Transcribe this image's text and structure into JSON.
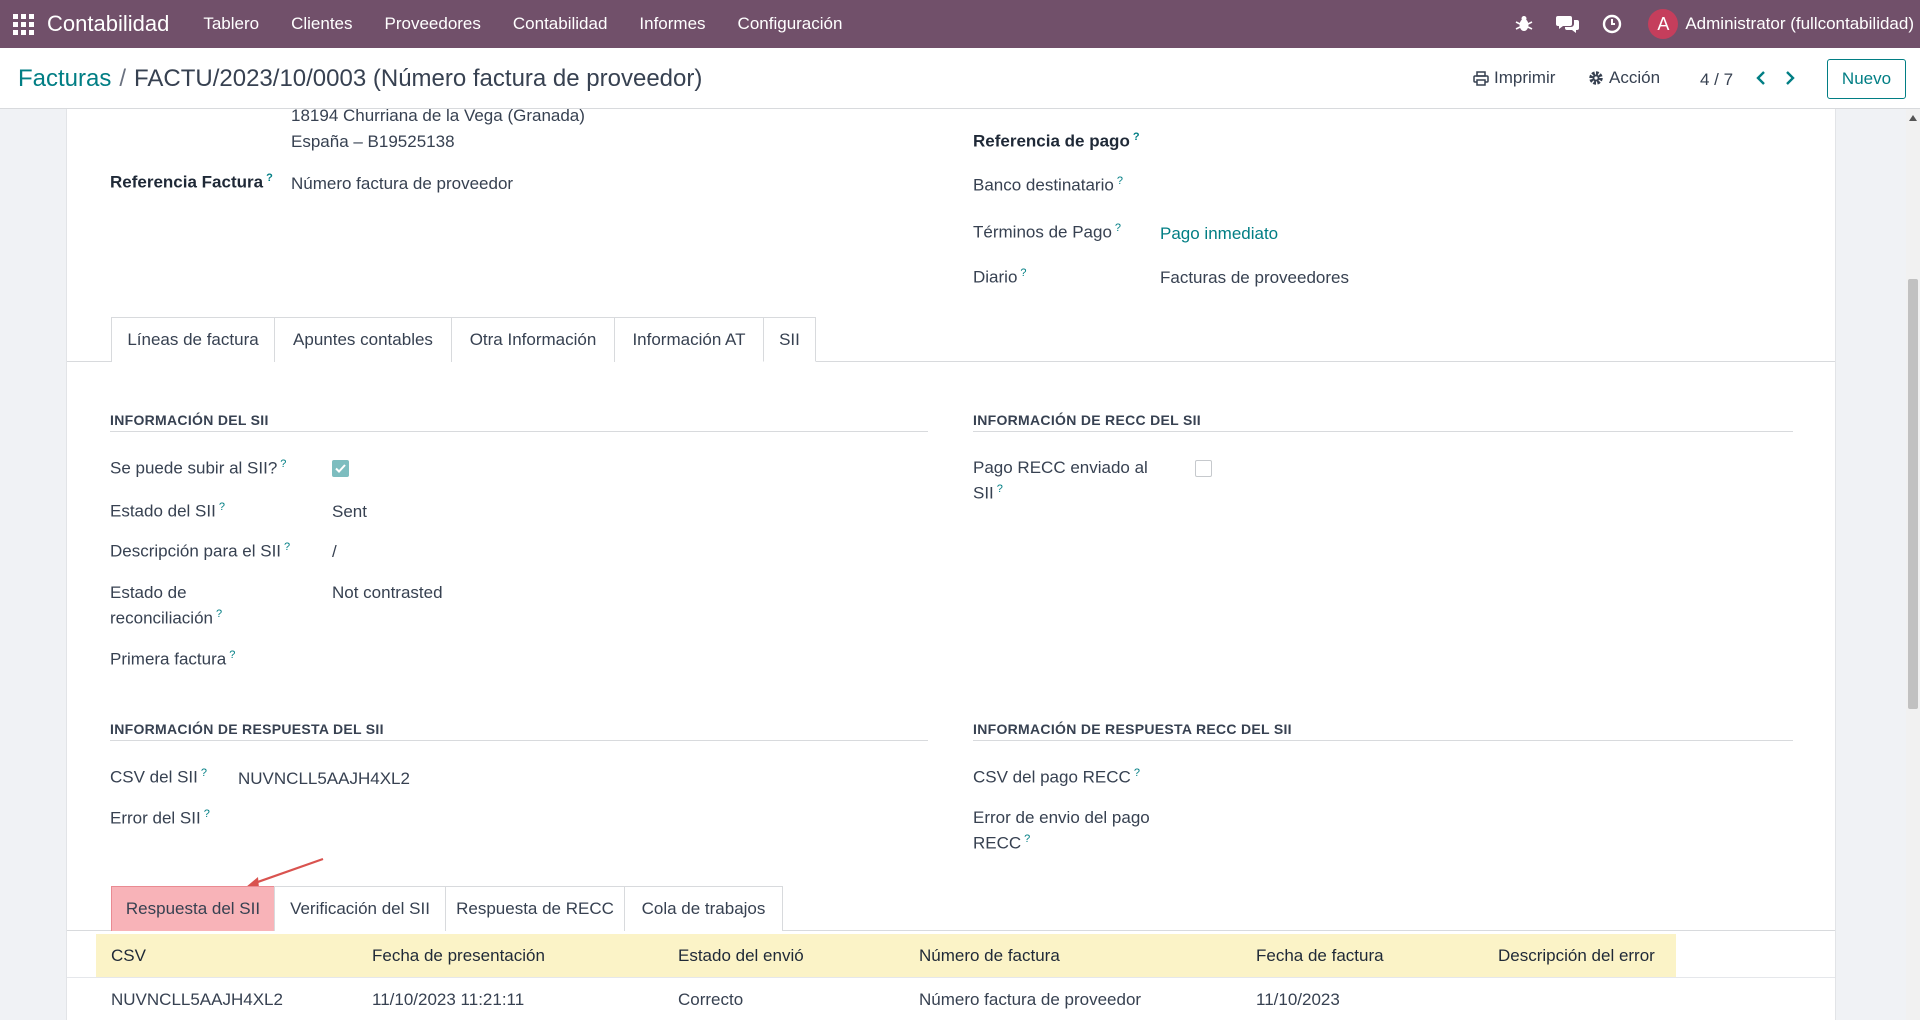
{
  "navbar": {
    "brand": "Contabilidad",
    "menu": [
      "Tablero",
      "Clientes",
      "Proveedores",
      "Contabilidad",
      "Informes",
      "Configuración"
    ],
    "avatar_letter": "A",
    "user": "Administrator (fullcontabilidad)"
  },
  "control": {
    "breadcrumb_parent": "Facturas",
    "breadcrumb_separator": "/",
    "breadcrumb_current": "FACTU/2023/10/0003 (Número factura de proveedor)",
    "print_label": "Imprimir",
    "action_label": "Acción",
    "pager": "4 / 7",
    "new_label": "Nuevo"
  },
  "partner": {
    "address_line": "18194 Churriana de la Vega (Granada)",
    "country_vat": "España – B19525138"
  },
  "fields_left": {
    "invoice_ref_label": "Referencia Factura",
    "invoice_ref_value": "Número factura de proveedor"
  },
  "fields_right": {
    "payment_ref_label": "Referencia de pago",
    "bank_label": "Banco destinatario",
    "terms_label": "Términos de Pago",
    "terms_value": "Pago inmediato",
    "journal_label": "Diario",
    "journal_value": "Facturas de proveedores"
  },
  "help_mark": "?",
  "tabs": [
    "Líneas de factura",
    "Apuntes contables",
    "Otra Información",
    "Información AT",
    "SII"
  ],
  "sii_info": {
    "title": "INFORMACIÓN DEL SII",
    "can_upload_label": "Se puede subir al SII?",
    "can_upload": true,
    "state_label": "Estado del SII",
    "state_value": "Sent",
    "desc_label": "Descripción para el SII",
    "desc_value": "/",
    "recon_label_1": "Estado de",
    "recon_label_2": "reconciliación",
    "recon_value": "Not contrasted",
    "first_invoice_label": "Primera factura"
  },
  "recc_info": {
    "title": "INFORMACIÓN DE RECC DEL SII",
    "sent_label_1": "Pago RECC enviado al",
    "sent_label_2": "SII",
    "sent": false
  },
  "sii_response": {
    "title": "INFORMACIÓN DE RESPUESTA DEL SII",
    "csv_label": "CSV del SII",
    "csv_value": "NUVNCLL5AAJH4XL2",
    "error_label": "Error del SII"
  },
  "recc_response": {
    "title": "INFORMACIÓN DE RESPUESTA RECC DEL SII",
    "csv_label": "CSV del pago RECC",
    "error_label_1": "Error de envio del pago",
    "error_label_2": "RECC"
  },
  "sub_tabs": [
    "Respuesta del SII",
    "Verificación del SII",
    "Respuesta de RECC",
    "Cola de trabajos"
  ],
  "table": {
    "columns": [
      "CSV",
      "Fecha de presentación",
      "Estado del envió",
      "Número de factura",
      "Fecha de factura",
      "Descripción del error"
    ],
    "rows": [
      [
        "NUVNCLL5AAJH4XL2",
        "11/10/2023 11:21:11",
        "Correcto",
        "Número factura de proveedor",
        "11/10/2023",
        ""
      ]
    ]
  },
  "colors": {
    "navbar": "#71506a",
    "accent": "#017e84",
    "highlight_tab": "#f8b3b8",
    "table_header": "#fbf3c7",
    "arrow": "#d9534f"
  }
}
